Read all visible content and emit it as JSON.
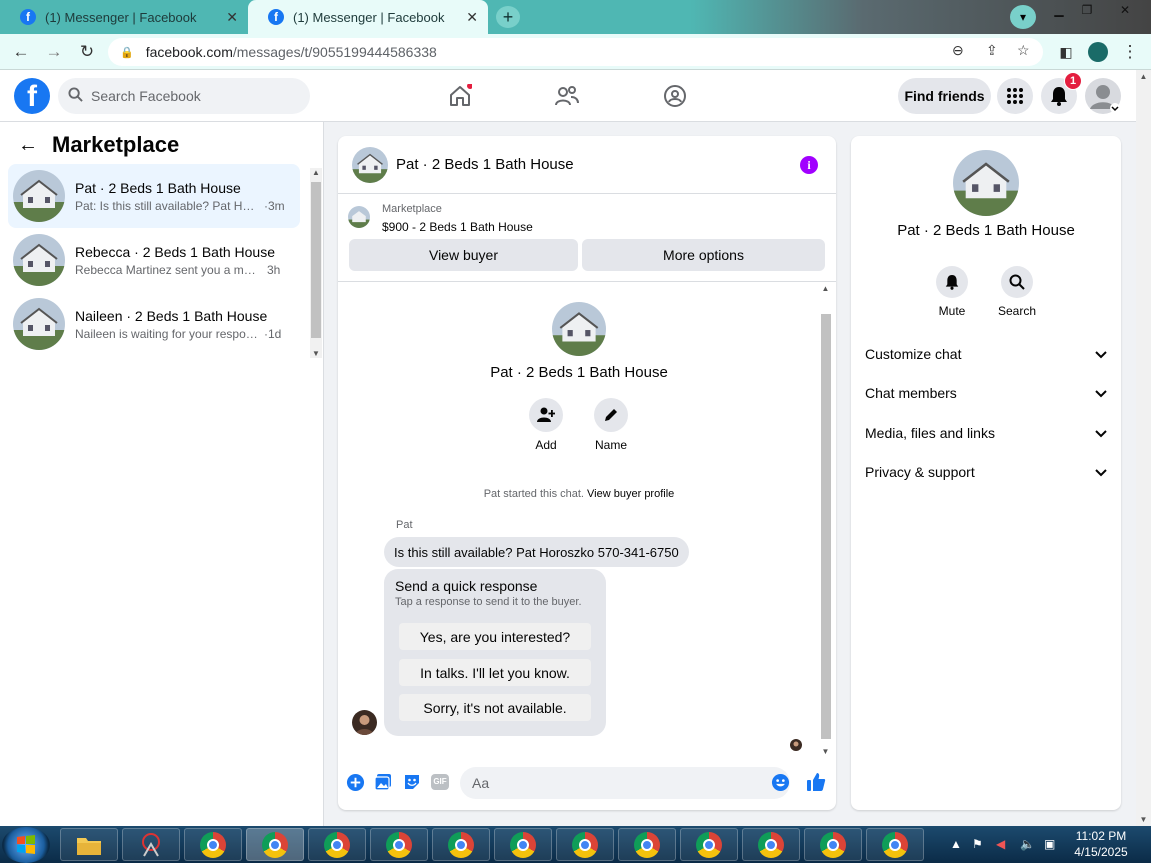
{
  "browser": {
    "tabs": [
      {
        "title": "(1) Messenger | Facebook",
        "active": false
      },
      {
        "title": "(1) Messenger | Facebook",
        "active": true
      }
    ],
    "url_host": "facebook.com",
    "url_path": "/messages/t/9055199444586338"
  },
  "header": {
    "search_placeholder": "Search Facebook",
    "find_friends_label": "Find friends",
    "notification_count": "1"
  },
  "sidebar": {
    "title": "Marketplace",
    "conversations": [
      {
        "name": "Pat · 2 Beds 1 Bath House",
        "preview": "Pat: Is this still available? Pat Horo...",
        "time": "·3m",
        "active": true
      },
      {
        "name": "Rebecca · 2 Beds 1 Bath House",
        "preview": "Rebecca Martinez sent you a mess...",
        "time": "3h",
        "active": false
      },
      {
        "name": "Naileen · 2 Beds 1 Bath House",
        "preview": "Naileen is waiting for your respon...",
        "time": "·1d",
        "active": false
      }
    ]
  },
  "chat": {
    "title": "Pat · 2 Beds 1 Bath House",
    "marketplace_label": "Marketplace",
    "listing": "$900 - 2 Beds 1 Bath House",
    "view_buyer_label": "View buyer",
    "more_options_label": "More options",
    "profile_name": "Pat · 2 Beds 1 Bath House",
    "actions": [
      {
        "label": "Add",
        "icon": "add-person-icon"
      },
      {
        "label": "Name",
        "icon": "pencil-icon"
      }
    ],
    "started_text": "Pat started this chat.",
    "view_buyer_profile": "View buyer profile",
    "sender_name": "Pat",
    "message": "Is this still available? Pat Horoszko 570-341-6750",
    "quick_response": {
      "title": "Send a quick response",
      "subtitle": "Tap a response to send it to the buyer.",
      "options": [
        "Yes, are you interested?",
        "In talks. I'll let you know.",
        "Sorry, it's not available."
      ]
    },
    "composer_placeholder": "Aa"
  },
  "details": {
    "name": "Pat · 2 Beds 1 Bath House",
    "actions": [
      {
        "label": "Mute",
        "icon": "bell-icon"
      },
      {
        "label": "Search",
        "icon": "search-icon"
      }
    ],
    "sections": [
      "Customize chat",
      "Chat members",
      "Media, files and links",
      "Privacy & support"
    ]
  },
  "taskbar": {
    "time": "11:02 PM",
    "date": "4/15/2025"
  },
  "colors": {
    "accent": "#1877f2",
    "info": "#a100ff",
    "badge": "#e41e3f",
    "tab_bar": "#4fb7b3"
  }
}
